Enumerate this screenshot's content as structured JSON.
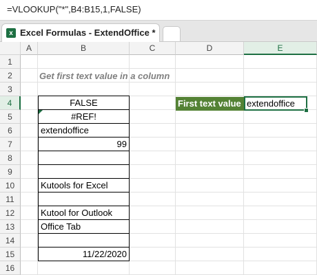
{
  "formula_bar": {
    "formula": "=VLOOKUP(\"*\",B4:B15,1,FALSE)"
  },
  "tab": {
    "title": "Excel Formulas - ExtendOffice *",
    "icon": "excel-icon"
  },
  "columns": [
    "A",
    "B",
    "C",
    "D",
    "E"
  ],
  "rows": [
    "1",
    "2",
    "3",
    "4",
    "5",
    "6",
    "7",
    "8",
    "9",
    "10",
    "11",
    "12",
    "13",
    "14",
    "15",
    "16"
  ],
  "selected_column": "E",
  "selected_row": "4",
  "heading": "Get first text value in a column",
  "column_b": [
    {
      "value": "FALSE",
      "align": "center"
    },
    {
      "value": "#REF!",
      "align": "center",
      "error_flag": true
    },
    {
      "value": "extendoffice",
      "align": "left"
    },
    {
      "value": "99",
      "align": "right"
    },
    {
      "value": "",
      "align": "left"
    },
    {
      "value": "",
      "align": "left"
    },
    {
      "value": "Kutools for Excel",
      "align": "left"
    },
    {
      "value": "",
      "align": "left"
    },
    {
      "value": "Kutool for Outlook",
      "align": "left"
    },
    {
      "value": "Office Tab",
      "align": "left"
    },
    {
      "value": "",
      "align": "left"
    },
    {
      "value": "11/22/2020",
      "align": "right"
    }
  ],
  "result": {
    "label": "First text value",
    "value": "extendoffice"
  },
  "colors": {
    "label_bg": "#548235",
    "selection": "#1d6f42",
    "heading": "#7f7f7f"
  }
}
